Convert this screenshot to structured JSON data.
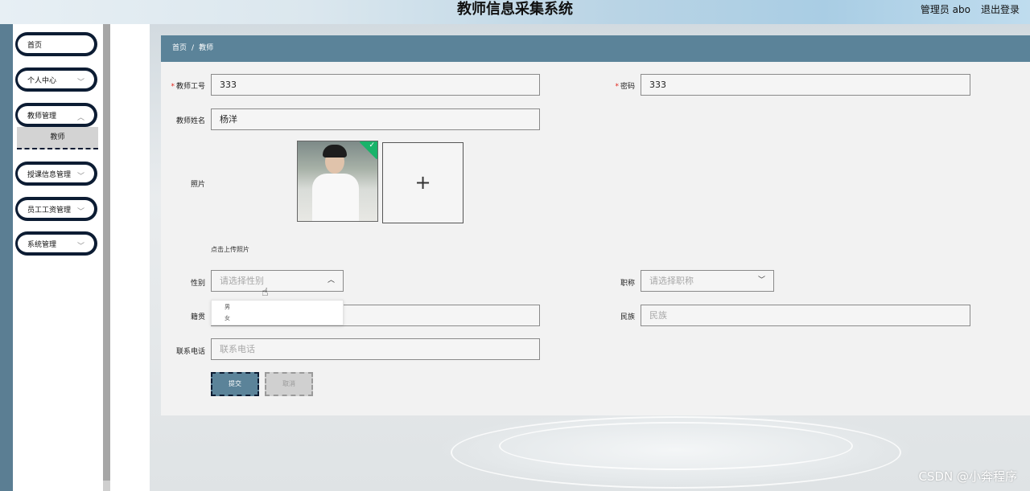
{
  "header": {
    "title": "教师信息采集系统",
    "admin_label": "管理员 abo",
    "logout_label": "退出登录"
  },
  "sidebar": {
    "items": [
      {
        "label": "首页",
        "has_chevron": false
      },
      {
        "label": "个人中心",
        "has_chevron": true
      },
      {
        "label": "教师管理",
        "has_chevron": true
      },
      {
        "label": "授课信息管理",
        "has_chevron": true
      },
      {
        "label": "员工工资管理",
        "has_chevron": true
      },
      {
        "label": "系统管理",
        "has_chevron": true
      }
    ],
    "sub_item": {
      "label": "教师"
    }
  },
  "breadcrumb": {
    "home": "首页",
    "separator": "/",
    "current": "教师"
  },
  "form": {
    "teacher_id": {
      "label": "教师工号",
      "value": "333"
    },
    "password": {
      "label": "密码",
      "value": "333"
    },
    "teacher_name": {
      "label": "教师姓名",
      "value": "杨洋"
    },
    "photo": {
      "label": "照片",
      "upload_hint": "点击上传照片",
      "plus": "+"
    },
    "gender": {
      "label": "性别",
      "placeholder": "请选择性别",
      "options": [
        "男",
        "女"
      ]
    },
    "title": {
      "label": "职称",
      "placeholder": "请选择职称"
    },
    "native_place": {
      "label": "籍贯",
      "placeholder": "籍贯"
    },
    "ethnicity": {
      "label": "民族",
      "placeholder": "民族"
    },
    "phone": {
      "label": "联系电话",
      "placeholder": "联系电话"
    },
    "required_mark": "*"
  },
  "buttons": {
    "submit": "提交",
    "cancel": "取消"
  },
  "watermark": "CSDN @小奔程序",
  "colors": {
    "accent": "#5b8399",
    "nav_border": "#0c1c33",
    "required": "#e2231a",
    "upload_success": "#19b36a"
  }
}
